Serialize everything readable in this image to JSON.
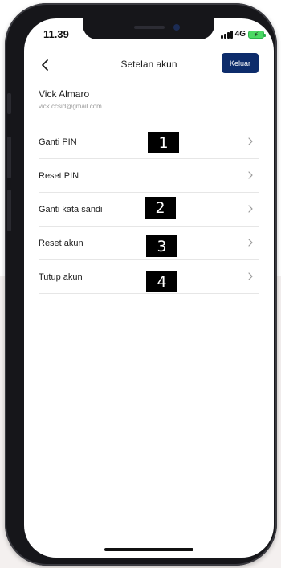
{
  "status_bar": {
    "time": "11.39",
    "network": "4G",
    "battery_bolt": "⚡"
  },
  "header": {
    "title": "Setelan akun",
    "back_icon": "chevron-left-icon",
    "logout_label": "Keluar"
  },
  "profile": {
    "name": "Vick Almaro",
    "email": "vick.ccsid@gmail.com"
  },
  "menu": {
    "items": [
      {
        "label": "Ganti PIN"
      },
      {
        "label": "Reset PIN"
      },
      {
        "label": "Ganti kata sandi"
      },
      {
        "label": "Reset akun"
      },
      {
        "label": "Tutup akun"
      }
    ],
    "chevron_icon": "chevron-right-icon"
  },
  "annotations": [
    "1",
    "2",
    "3",
    "4"
  ],
  "colors": {
    "primary_button": "#0d2c6b",
    "battery": "#4cd964",
    "annotation_bg": "#000000"
  }
}
